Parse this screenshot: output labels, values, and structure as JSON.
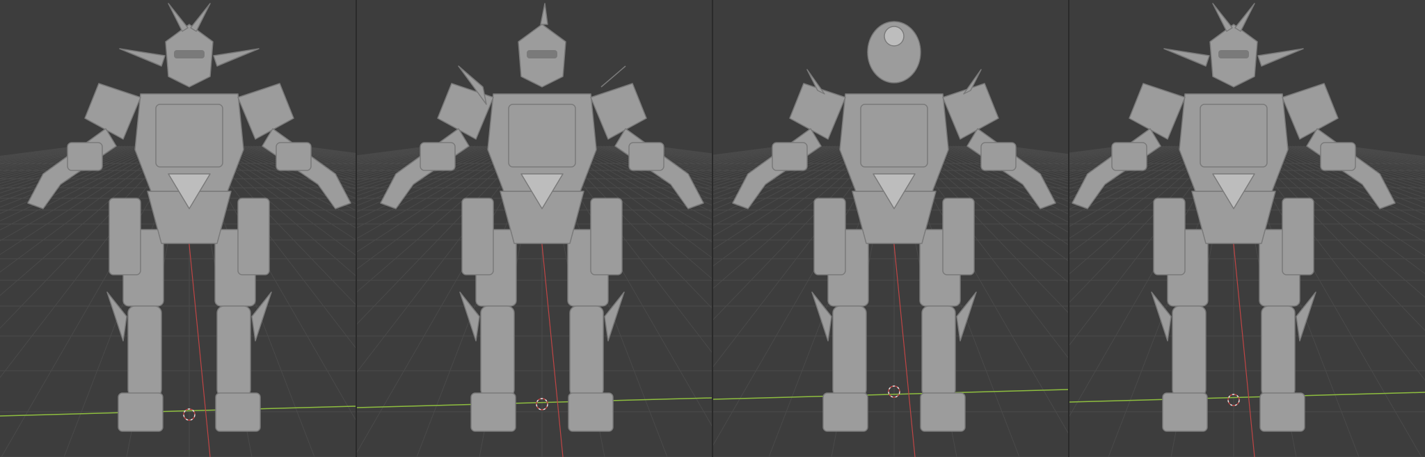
{
  "panels": [
    {
      "id": "render-1",
      "variant": "spiked-helmet"
    },
    {
      "id": "render-2",
      "variant": "visor-helmet"
    },
    {
      "id": "render-3",
      "variant": "dome-helmet"
    },
    {
      "id": "render-4",
      "variant": "horned-helmet"
    }
  ],
  "colors": {
    "background": "#3d3d3d",
    "grid_line": "#4a4a4a",
    "x_axis": "#8fbf3f",
    "y_axis": "#c04545",
    "model": "#9c9c9c",
    "model_shadow": "#7a7a7a",
    "model_highlight": "#bdbdbd",
    "origin_cursor": "#e8e8e8"
  }
}
